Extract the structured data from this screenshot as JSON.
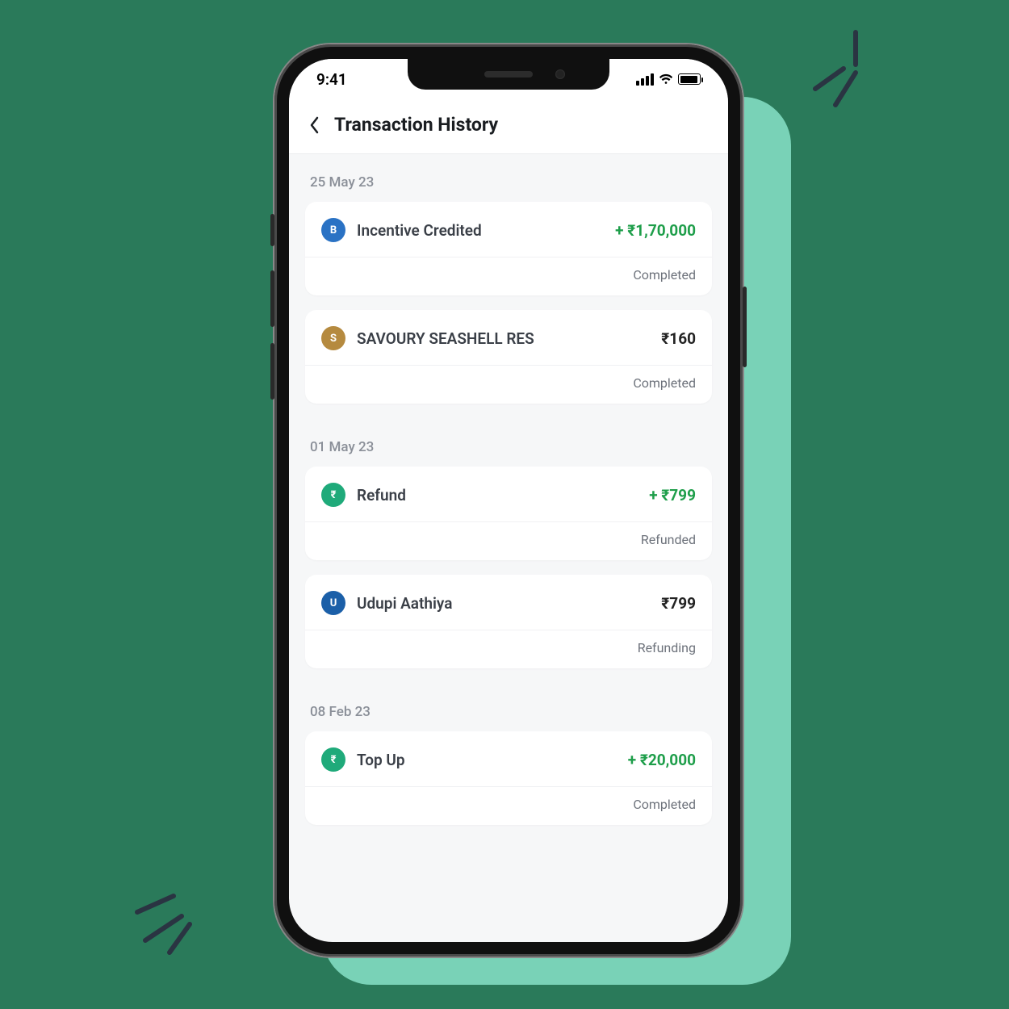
{
  "status_bar": {
    "time": "9:41"
  },
  "header": {
    "title": "Transaction History"
  },
  "colors": {
    "blue": "#2a72c4",
    "bronze": "#b58a3f",
    "teal": "#1faa7a",
    "darkblue": "#1b5fa8"
  },
  "groups": [
    {
      "date": "25 May 23",
      "transactions": [
        {
          "icon_letter": "B",
          "icon_color": "blue",
          "title": "Incentive Credited",
          "amount": "+ ₹1,70,000",
          "amount_type": "credit",
          "status": "Completed"
        },
        {
          "icon_letter": "S",
          "icon_color": "bronze",
          "title": "SAVOURY SEASHELL RES",
          "amount": "₹160",
          "amount_type": "debit",
          "status": "Completed"
        }
      ]
    },
    {
      "date": "01 May 23",
      "transactions": [
        {
          "icon_letter": "₹",
          "icon_color": "teal",
          "title": "Refund",
          "amount": "+ ₹799",
          "amount_type": "credit",
          "status": "Refunded"
        },
        {
          "icon_letter": "U",
          "icon_color": "darkblue",
          "title": "Udupi Aathiya",
          "amount": "₹799",
          "amount_type": "debit",
          "status": "Refunding"
        }
      ]
    },
    {
      "date": "08 Feb 23",
      "transactions": [
        {
          "icon_letter": "₹",
          "icon_color": "teal",
          "title": "Top Up",
          "amount": "+ ₹20,000",
          "amount_type": "credit",
          "status": "Completed"
        }
      ]
    }
  ]
}
